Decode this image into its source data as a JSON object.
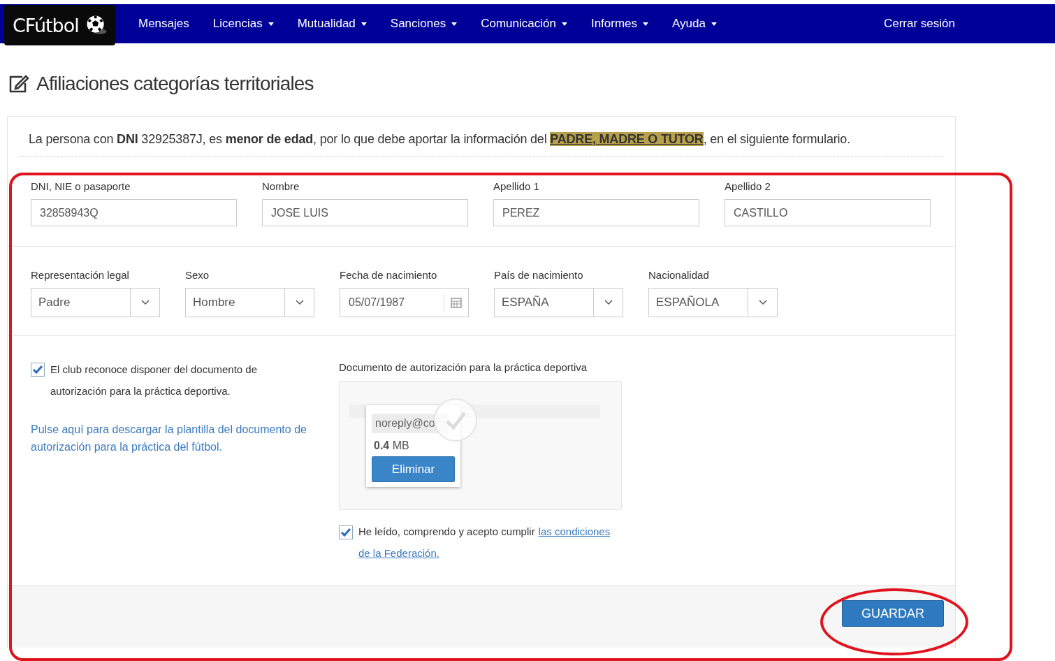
{
  "navbar": {
    "brand": "CFútbol",
    "items": [
      {
        "label": "Mensajes",
        "dropdown": false
      },
      {
        "label": "Licencias",
        "dropdown": true
      },
      {
        "label": "Mutualidad",
        "dropdown": true
      },
      {
        "label": "Sanciones",
        "dropdown": true
      },
      {
        "label": "Comunicación",
        "dropdown": true
      },
      {
        "label": "Informes",
        "dropdown": true
      },
      {
        "label": "Ayuda",
        "dropdown": true
      }
    ],
    "logout": "Cerrar sesión"
  },
  "page_title": "Afiliaciones categorías territoriales",
  "notice": [
    {
      "kind": "plain",
      "text": "La persona con **DNI** 32925387J, es **menor de edad**, por lo que debe aportar la información del "
    },
    {
      "kind": "highlight",
      "text": "PADRE, MADRE O TUTOR"
    },
    {
      "kind": "plain",
      "text": ", en el siguiente formulario."
    }
  ],
  "identity_fields": [
    {
      "label": "DNI, NIE o pasaporte",
      "value": "32858943Q"
    },
    {
      "label": "Nombre",
      "value": "JOSE LUIS"
    },
    {
      "label": "Apellido 1",
      "value": "PEREZ"
    },
    {
      "label": "Apellido 2",
      "value": "CASTILLO"
    }
  ],
  "detail_fields": [
    {
      "label": "Representación legal",
      "value": "Padre",
      "kind": "select"
    },
    {
      "label": "Sexo",
      "value": "Hombre",
      "kind": "select"
    },
    {
      "label": "Fecha de nacimiento",
      "value": "05/07/1987",
      "kind": "date"
    },
    {
      "label": "País de nacimiento",
      "value": "ESPAÑA",
      "kind": "select"
    },
    {
      "label": "Nacionalidad",
      "value": "ESPAÑOLA",
      "kind": "select"
    }
  ],
  "club_acknowledgement": {
    "checked": true,
    "text": "El club reconoce disponer del documento de autorización para la práctica deportiva."
  },
  "template_link": "Pulse aquí para descargar la plantilla del documento de autorización para la práctica del fútbol.",
  "document": {
    "label": "Documento de autorización para la práctica deportiva",
    "file": {
      "name": "noreply@co",
      "size": "**0.4** MB",
      "remove_button": "Eliminar"
    }
  },
  "terms": {
    "checked": true,
    "text": "He leído, comprendo y acepto cumplir",
    "link": [
      "las condiciones",
      "de la Federación."
    ]
  },
  "save_button": "GUARDAR"
}
